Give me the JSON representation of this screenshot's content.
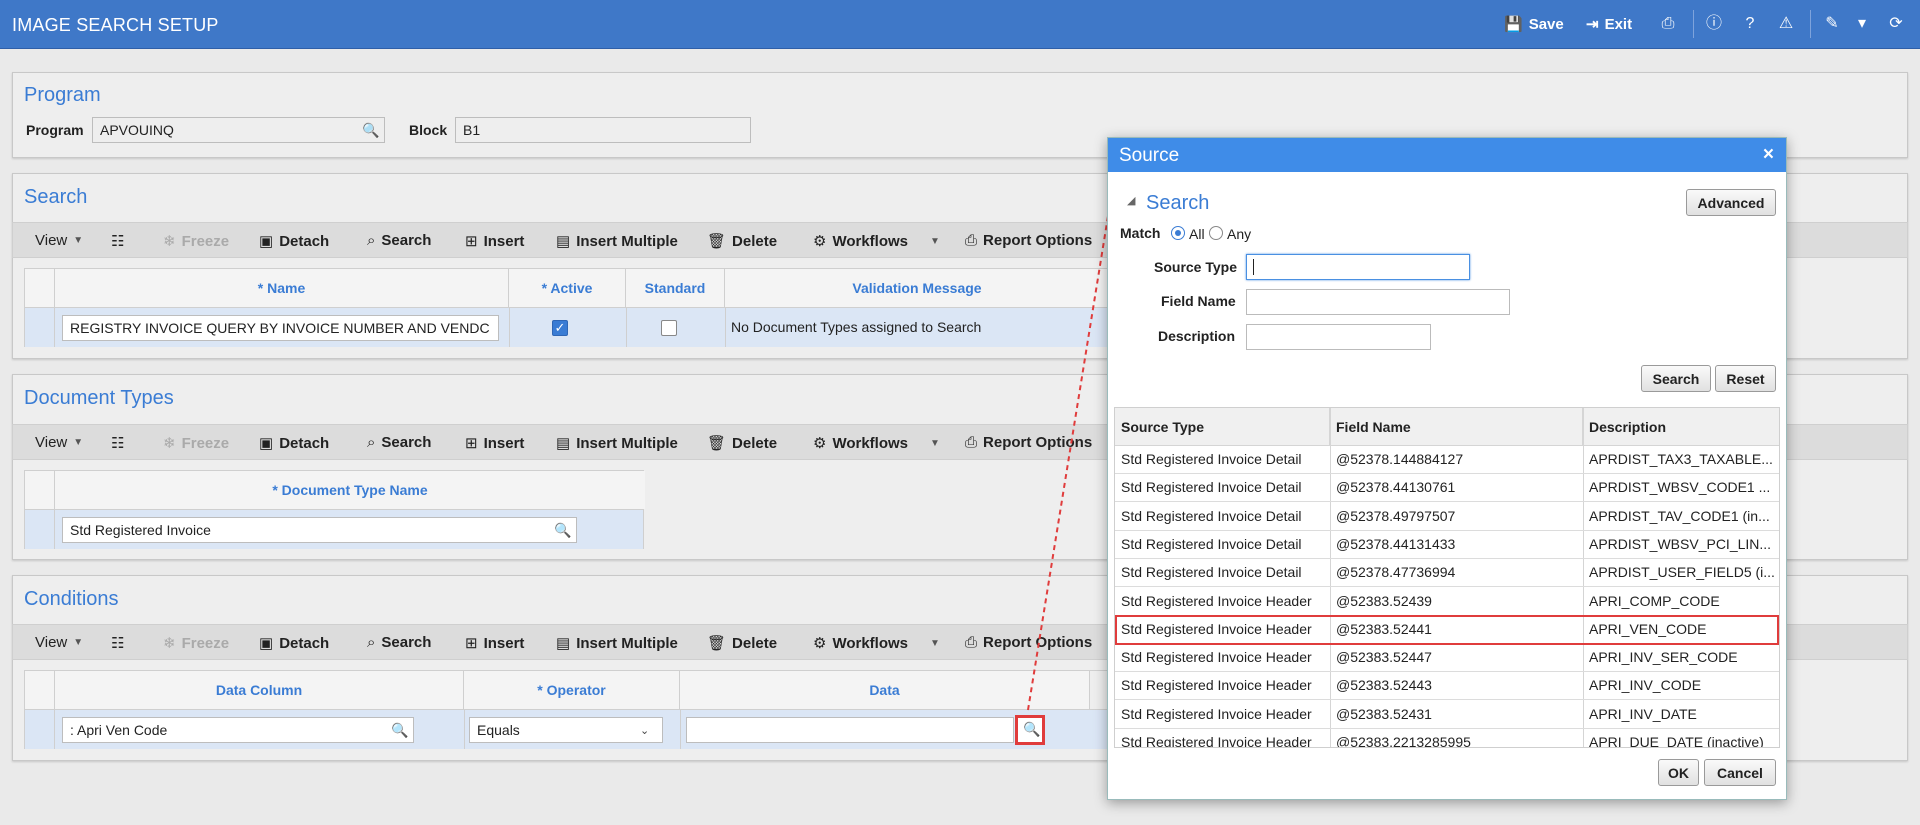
{
  "app": {
    "title": "IMAGE SEARCH SETUP",
    "save": "Save",
    "exit": "Exit"
  },
  "program": {
    "title": "Program",
    "program_label": "Program",
    "program_value": "APVOUINQ",
    "block_label": "Block",
    "block_value": "B1"
  },
  "toolbar": {
    "view": "View",
    "freeze": "Freeze",
    "detach": "Detach",
    "search": "Search",
    "insert": "Insert",
    "insert_multiple": "Insert Multiple",
    "delete": "Delete",
    "workflows": "Workflows",
    "report_options": "Report Options"
  },
  "search": {
    "title": "Search",
    "col_name": "* Name",
    "col_active": "* Active",
    "col_standard": "Standard",
    "col_validation": "Validation Message",
    "row_name": "REGISTRY INVOICE QUERY BY INVOICE NUMBER AND VENDC",
    "row_active": true,
    "row_standard": false,
    "row_validation": "No Document Types assigned to Search"
  },
  "doctypes": {
    "title": "Document Types",
    "col_name": "* Document Type Name",
    "row_value": "Std Registered Invoice"
  },
  "conditions": {
    "title": "Conditions",
    "col_data_column": "Data Column",
    "col_operator": "* Operator",
    "col_data": "Data",
    "row_data_column": ": Apri Ven Code",
    "row_operator": "Equals"
  },
  "dialog": {
    "title": "Source",
    "close": "×",
    "search_heading": "Search",
    "advanced": "Advanced",
    "match_label": "Match",
    "match_all": "All",
    "match_any": "Any",
    "match_selected": "All",
    "source_type_label": "Source Type",
    "field_name_label": "Field Name",
    "description_label": "Description",
    "search_btn": "Search",
    "reset_btn": "Reset",
    "ok_btn": "OK",
    "cancel_btn": "Cancel",
    "columns": [
      "Source Type",
      "Field Name",
      "Description"
    ],
    "rows": [
      [
        "Std Registered Invoice Detail",
        "@52378.144884127",
        "APRDIST_TAX3_TAXABLE..."
      ],
      [
        "Std Registered Invoice Detail",
        "@52378.44130761",
        "APRDIST_WBSV_CODE1 ..."
      ],
      [
        "Std Registered Invoice Detail",
        "@52378.49797507",
        "APRDIST_TAV_CODE1 (in..."
      ],
      [
        "Std Registered Invoice Detail",
        "@52378.44131433",
        "APRDIST_WBSV_PCI_LIN..."
      ],
      [
        "Std Registered Invoice Detail",
        "@52378.47736994",
        "APRDIST_USER_FIELD5 (i..."
      ],
      [
        "Std Registered Invoice Header",
        "@52383.52439",
        "APRI_COMP_CODE"
      ],
      [
        "Std Registered Invoice Header",
        "@52383.52441",
        "APRI_VEN_CODE"
      ],
      [
        "Std Registered Invoice Header",
        "@52383.52447",
        "APRI_INV_SER_CODE"
      ],
      [
        "Std Registered Invoice Header",
        "@52383.52443",
        "APRI_INV_CODE"
      ],
      [
        "Std Registered Invoice Header",
        "@52383.52431",
        "APRI_INV_DATE"
      ],
      [
        "Std Registered Invoice Header",
        "@52383.2213285995",
        "APRI_DUE_DATE (inactive)"
      ]
    ],
    "highlighted_row": "@52383.52441"
  },
  "colors": {
    "titlebar": "#3f78c8",
    "accent": "#3a7cd4",
    "dialog_header": "#3f8ce8",
    "highlight": "#e03c3c"
  }
}
